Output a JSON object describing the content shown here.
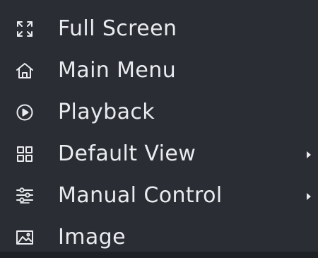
{
  "menu": {
    "items": [
      {
        "label": "Full Screen",
        "icon": "fullscreen-icon",
        "has_submenu": false
      },
      {
        "label": "Main Menu",
        "icon": "home-icon",
        "has_submenu": false
      },
      {
        "label": "Playback",
        "icon": "play-circle-icon",
        "has_submenu": false
      },
      {
        "label": "Default View",
        "icon": "grid-view-icon",
        "has_submenu": true
      },
      {
        "label": "Manual Control",
        "icon": "sliders-icon",
        "has_submenu": true
      },
      {
        "label": "Image",
        "icon": "image-icon",
        "has_submenu": false
      }
    ]
  },
  "colors": {
    "background": "#2a2e34",
    "text": "#e9ebee"
  }
}
